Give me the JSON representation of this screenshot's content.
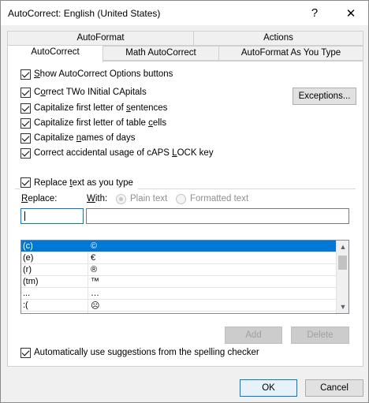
{
  "window": {
    "title": "AutoCorrect: English (United States)",
    "help": "?",
    "close": "✕"
  },
  "tabs_back": [
    "AutoFormat",
    "Actions"
  ],
  "tabs_front": [
    "AutoCorrect",
    "Math AutoCorrect",
    "AutoFormat As You Type"
  ],
  "options": {
    "show_buttons": {
      "pre": "",
      "u": "S",
      "post": "how AutoCorrect Options buttons"
    },
    "two_initial": {
      "pre": "C",
      "u": "o",
      "post": "rrect TWo INitial CApitals"
    },
    "sentences": {
      "pre": "Capitalize first letter of ",
      "u": "s",
      "post": "entences"
    },
    "table_cells": {
      "pre": "Capitalize first letter of table ",
      "u": "c",
      "post": "ells"
    },
    "days": {
      "pre": "Capitalize ",
      "u": "n",
      "post": "ames of days"
    },
    "caps_lock": {
      "pre": "Correct accidental usage of cAPS ",
      "u": "L",
      "post": "OCK key"
    }
  },
  "exceptions_button": "Exceptions...",
  "replace_group": {
    "label_pre": "Replace ",
    "label_u": "t",
    "label_post": "ext as you type",
    "replace_u": "R",
    "replace_rest": "eplace:",
    "with_u": "W",
    "with_rest": "ith:",
    "plain": "Plain text",
    "formatted": "Formatted text",
    "replace_value": "",
    "with_value": ""
  },
  "entries": [
    {
      "from": "(c)",
      "to": "©"
    },
    {
      "from": "(e)",
      "to": "€"
    },
    {
      "from": "(r)",
      "to": "®"
    },
    {
      "from": "(tm)",
      "to": "™"
    },
    {
      "from": "...",
      "to": "…"
    },
    {
      "from": ":(",
      "to": "☹"
    }
  ],
  "add_button": "Add",
  "delete_button": "Delete",
  "suggestions": "Automatically use suggestions from the spelling checker",
  "ok": "OK",
  "cancel": "Cancel"
}
